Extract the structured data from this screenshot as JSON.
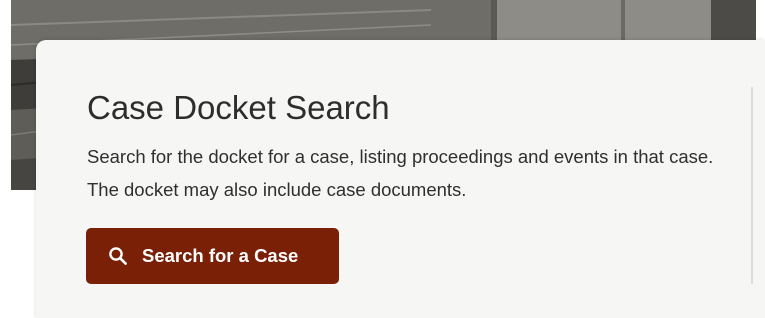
{
  "panel": {
    "title": "Case Docket Search",
    "description": "Search for the docket for a case, listing proceedings and events in that case. The docket may also include case documents.",
    "button_label": "Search for a Case",
    "button_icon": "search-icon"
  },
  "colors": {
    "button_background": "#7a2007",
    "button_text": "#ffffff",
    "card_background": "#f6f6f5",
    "title_text": "#2d2d2d"
  }
}
